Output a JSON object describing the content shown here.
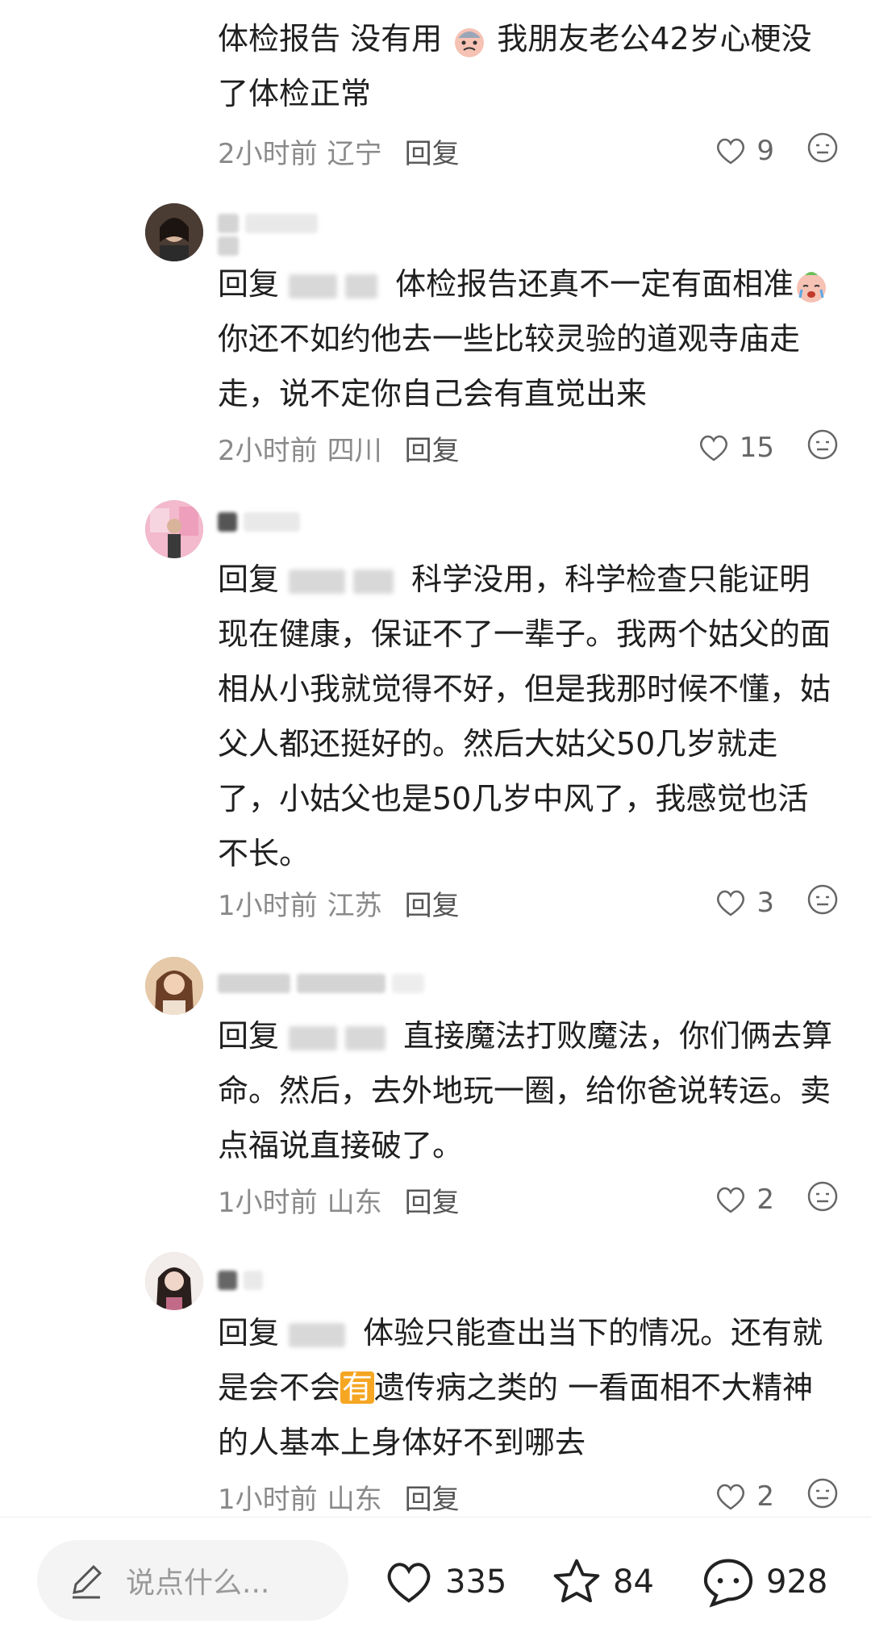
{
  "comments": [
    {
      "text_a": "体检报告 没有用",
      "text_b": "我朋友老公42岁心梗没了体检正常",
      "time": "2小时前",
      "location": "辽宁",
      "reply_label": "回复",
      "likes": "9"
    },
    {
      "reply_prefix": "回复",
      "text_a": "体检报告还真不一定有面相准",
      "text_b": "你还不如约他去一些比较灵验的道观寺庙走走，说不定你自己会有直觉出来",
      "time": "2小时前",
      "location": "四川",
      "reply_label": "回复",
      "likes": "15"
    },
    {
      "reply_prefix": "回复",
      "text": "科学没用，科学检查只能证明现在健康，保证不了一辈子。我两个姑父的面相从小我就觉得不好，但是我那时候不懂，姑父人都还挺好的。然后大姑父50几岁就走了，小姑父也是50几岁中风了，我感觉也活不长。",
      "time": "1小时前",
      "location": "江苏",
      "reply_label": "回复",
      "likes": "3"
    },
    {
      "reply_prefix": "回复",
      "text": "直接魔法打败魔法，你们俩去算命。然后，去外地玩一圈，给你爸说转运。卖点福说直接破了。",
      "time": "1小时前",
      "location": "山东",
      "reply_label": "回复",
      "likes": "2"
    },
    {
      "reply_prefix": "回复",
      "text_a": "体验只能查出当下的情况。还有就是会不会",
      "highlight": "有",
      "text_b": "遗传病之类的 一看面相不大精神的人基本上身体好不到哪去",
      "time": "1小时前",
      "location": "山东",
      "reply_label": "回复",
      "likes": "2"
    }
  ],
  "bottom_bar": {
    "input_placeholder": "说点什么...",
    "likes_count": "335",
    "favorites_count": "84",
    "comments_count": "928"
  },
  "colors": {
    "highlight": "#f5a623",
    "meta_text": "#8a8a8a"
  },
  "icons": [
    "heart-icon",
    "react-emoji-icon",
    "pen-icon",
    "star-icon",
    "chat-bubble-icon",
    "avatar"
  ]
}
